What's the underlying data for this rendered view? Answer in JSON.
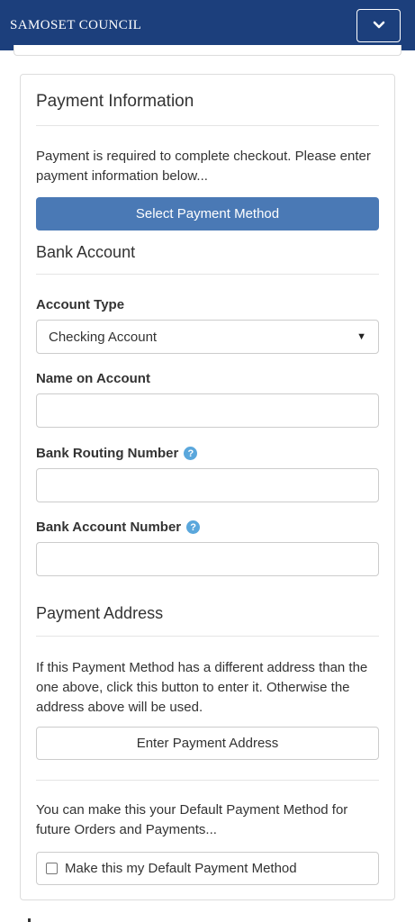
{
  "navbar": {
    "brand": "SAMOSET COUNCIL",
    "toggle_icon": "chevron-down-icon"
  },
  "payment_info": {
    "title": "Payment Information",
    "intro": "Payment is required to complete checkout. Please enter payment information below...",
    "select_button": "Select Payment Method"
  },
  "bank_account": {
    "title": "Bank Account",
    "account_type_label": "Account Type",
    "account_type_value": "Checking Account",
    "name_label": "Name on Account",
    "name_value": "",
    "routing_label": "Bank Routing Number",
    "routing_value": "",
    "account_number_label": "Bank Account Number",
    "account_number_value": "",
    "help_icon": "question-circle-icon",
    "help_glyph": "?"
  },
  "payment_address": {
    "title": "Payment Address",
    "description": "If this Payment Method has a different address than the one above, click this button to enter it. Otherwise the address above will be used.",
    "button": "Enter Payment Address"
  },
  "default_method": {
    "description": "You can make this your Default Payment Method for future Orders and Payments...",
    "checkbox_label": "Make this my Default Payment Method",
    "checked": false
  },
  "colors": {
    "navbar": "#1c3f7c",
    "primary_button": "#4a79b5",
    "help_icon": "#5aa7dc"
  }
}
